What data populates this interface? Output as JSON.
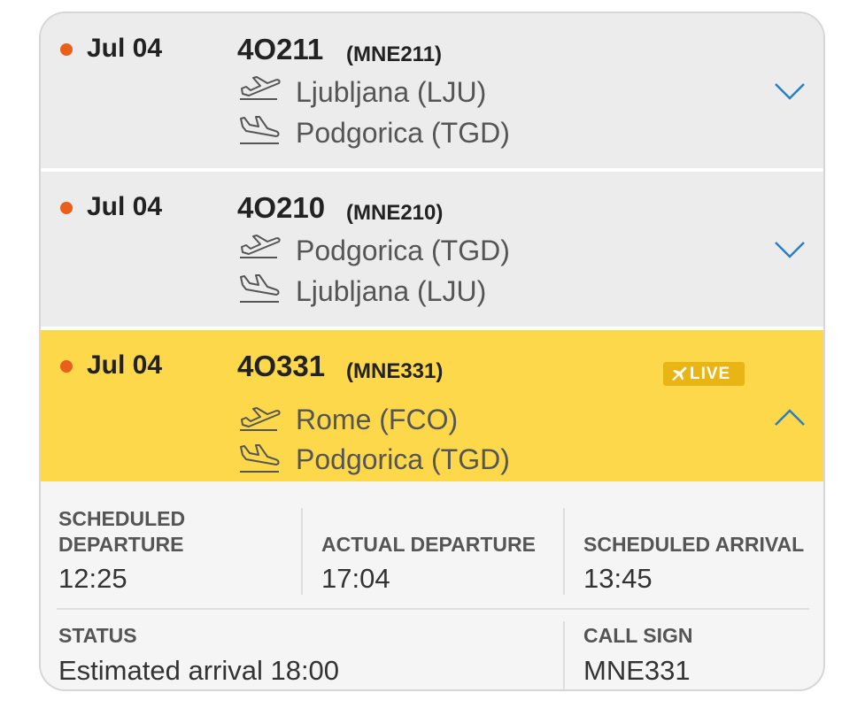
{
  "flights": [
    {
      "date": "Jul 04",
      "flight_number": "4O211",
      "callsign": "(MNE211)",
      "origin": "Ljubljana (LJU)",
      "destination": "Podgorica (TGD)",
      "expanded": false
    },
    {
      "date": "Jul 04",
      "flight_number": "4O210",
      "callsign": "(MNE210)",
      "origin": "Podgorica (TGD)",
      "destination": "Ljubljana (LJU)",
      "expanded": false
    },
    {
      "date": "Jul 04",
      "flight_number": "4O331",
      "callsign": "(MNE331)",
      "origin": "Rome (FCO)",
      "destination": "Podgorica (TGD)",
      "live_badge": "LIVE",
      "expanded": true
    }
  ],
  "details": {
    "scheduled_departure_label_1": "SCHEDULED",
    "scheduled_departure_label_2": "DEPARTURE",
    "scheduled_departure": "12:25",
    "actual_departure_label": "ACTUAL DEPARTURE",
    "actual_departure": "17:04",
    "scheduled_arrival_label": "SCHEDULED ARRIVAL",
    "scheduled_arrival": "13:45",
    "status_label": "STATUS",
    "status": "Estimated arrival 18:00",
    "call_sign_label": "CALL SIGN",
    "call_sign": "MNE331"
  },
  "colors": {
    "highlight": "#fdd84a",
    "status_dot": "#e8601c",
    "live_badge": "#e9b515",
    "chevron": "#2a7fc1"
  },
  "icons": {
    "departure": "plane-takeoff-icon",
    "arrival": "plane-landing-icon",
    "collapse": "chevron-up-icon",
    "expand": "chevron-down-icon"
  }
}
